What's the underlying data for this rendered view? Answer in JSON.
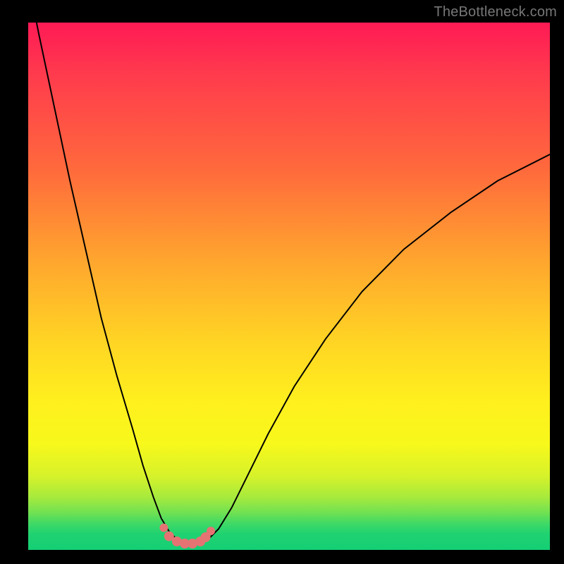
{
  "watermark": "TheBottleneck.com",
  "colors": {
    "background": "#000000",
    "grad_top": "#ff1a55",
    "grad_bottom": "#15cf75",
    "curve": "#000000",
    "marker": "#e57373"
  },
  "chart_data": {
    "type": "line",
    "title": "",
    "xlabel": "",
    "ylabel": "",
    "xlim": [
      0,
      100
    ],
    "ylim": [
      0,
      100
    ],
    "x": [
      0,
      2,
      5,
      8,
      11,
      14,
      17,
      20,
      22,
      24,
      25.5,
      27,
      28.5,
      30,
      31,
      32,
      33,
      34.5,
      36.5,
      39,
      42,
      46,
      51,
      57,
      64,
      72,
      81,
      90,
      100
    ],
    "y": [
      108,
      98,
      84,
      70,
      57,
      44,
      33,
      23,
      16,
      10,
      6,
      3.5,
      2,
      1.3,
      1.1,
      1.1,
      1.3,
      2,
      4,
      8,
      14,
      22,
      31,
      40,
      49,
      57,
      64,
      70,
      75
    ],
    "markers": {
      "x": [
        26,
        27,
        28.5,
        30,
        31.5,
        33,
        34,
        35
      ],
      "y": [
        4.2,
        2.6,
        1.6,
        1.2,
        1.2,
        1.6,
        2.4,
        3.6
      ]
    },
    "notes": "Axes unlabeled in source; x/y are normalized 0–100. Curve resembles a sharp V-shaped dip near x≈31 with an asymmetric rise; left branch enters from top-left, right branch exits mid-right. Dotted pink markers cluster at the trough."
  }
}
